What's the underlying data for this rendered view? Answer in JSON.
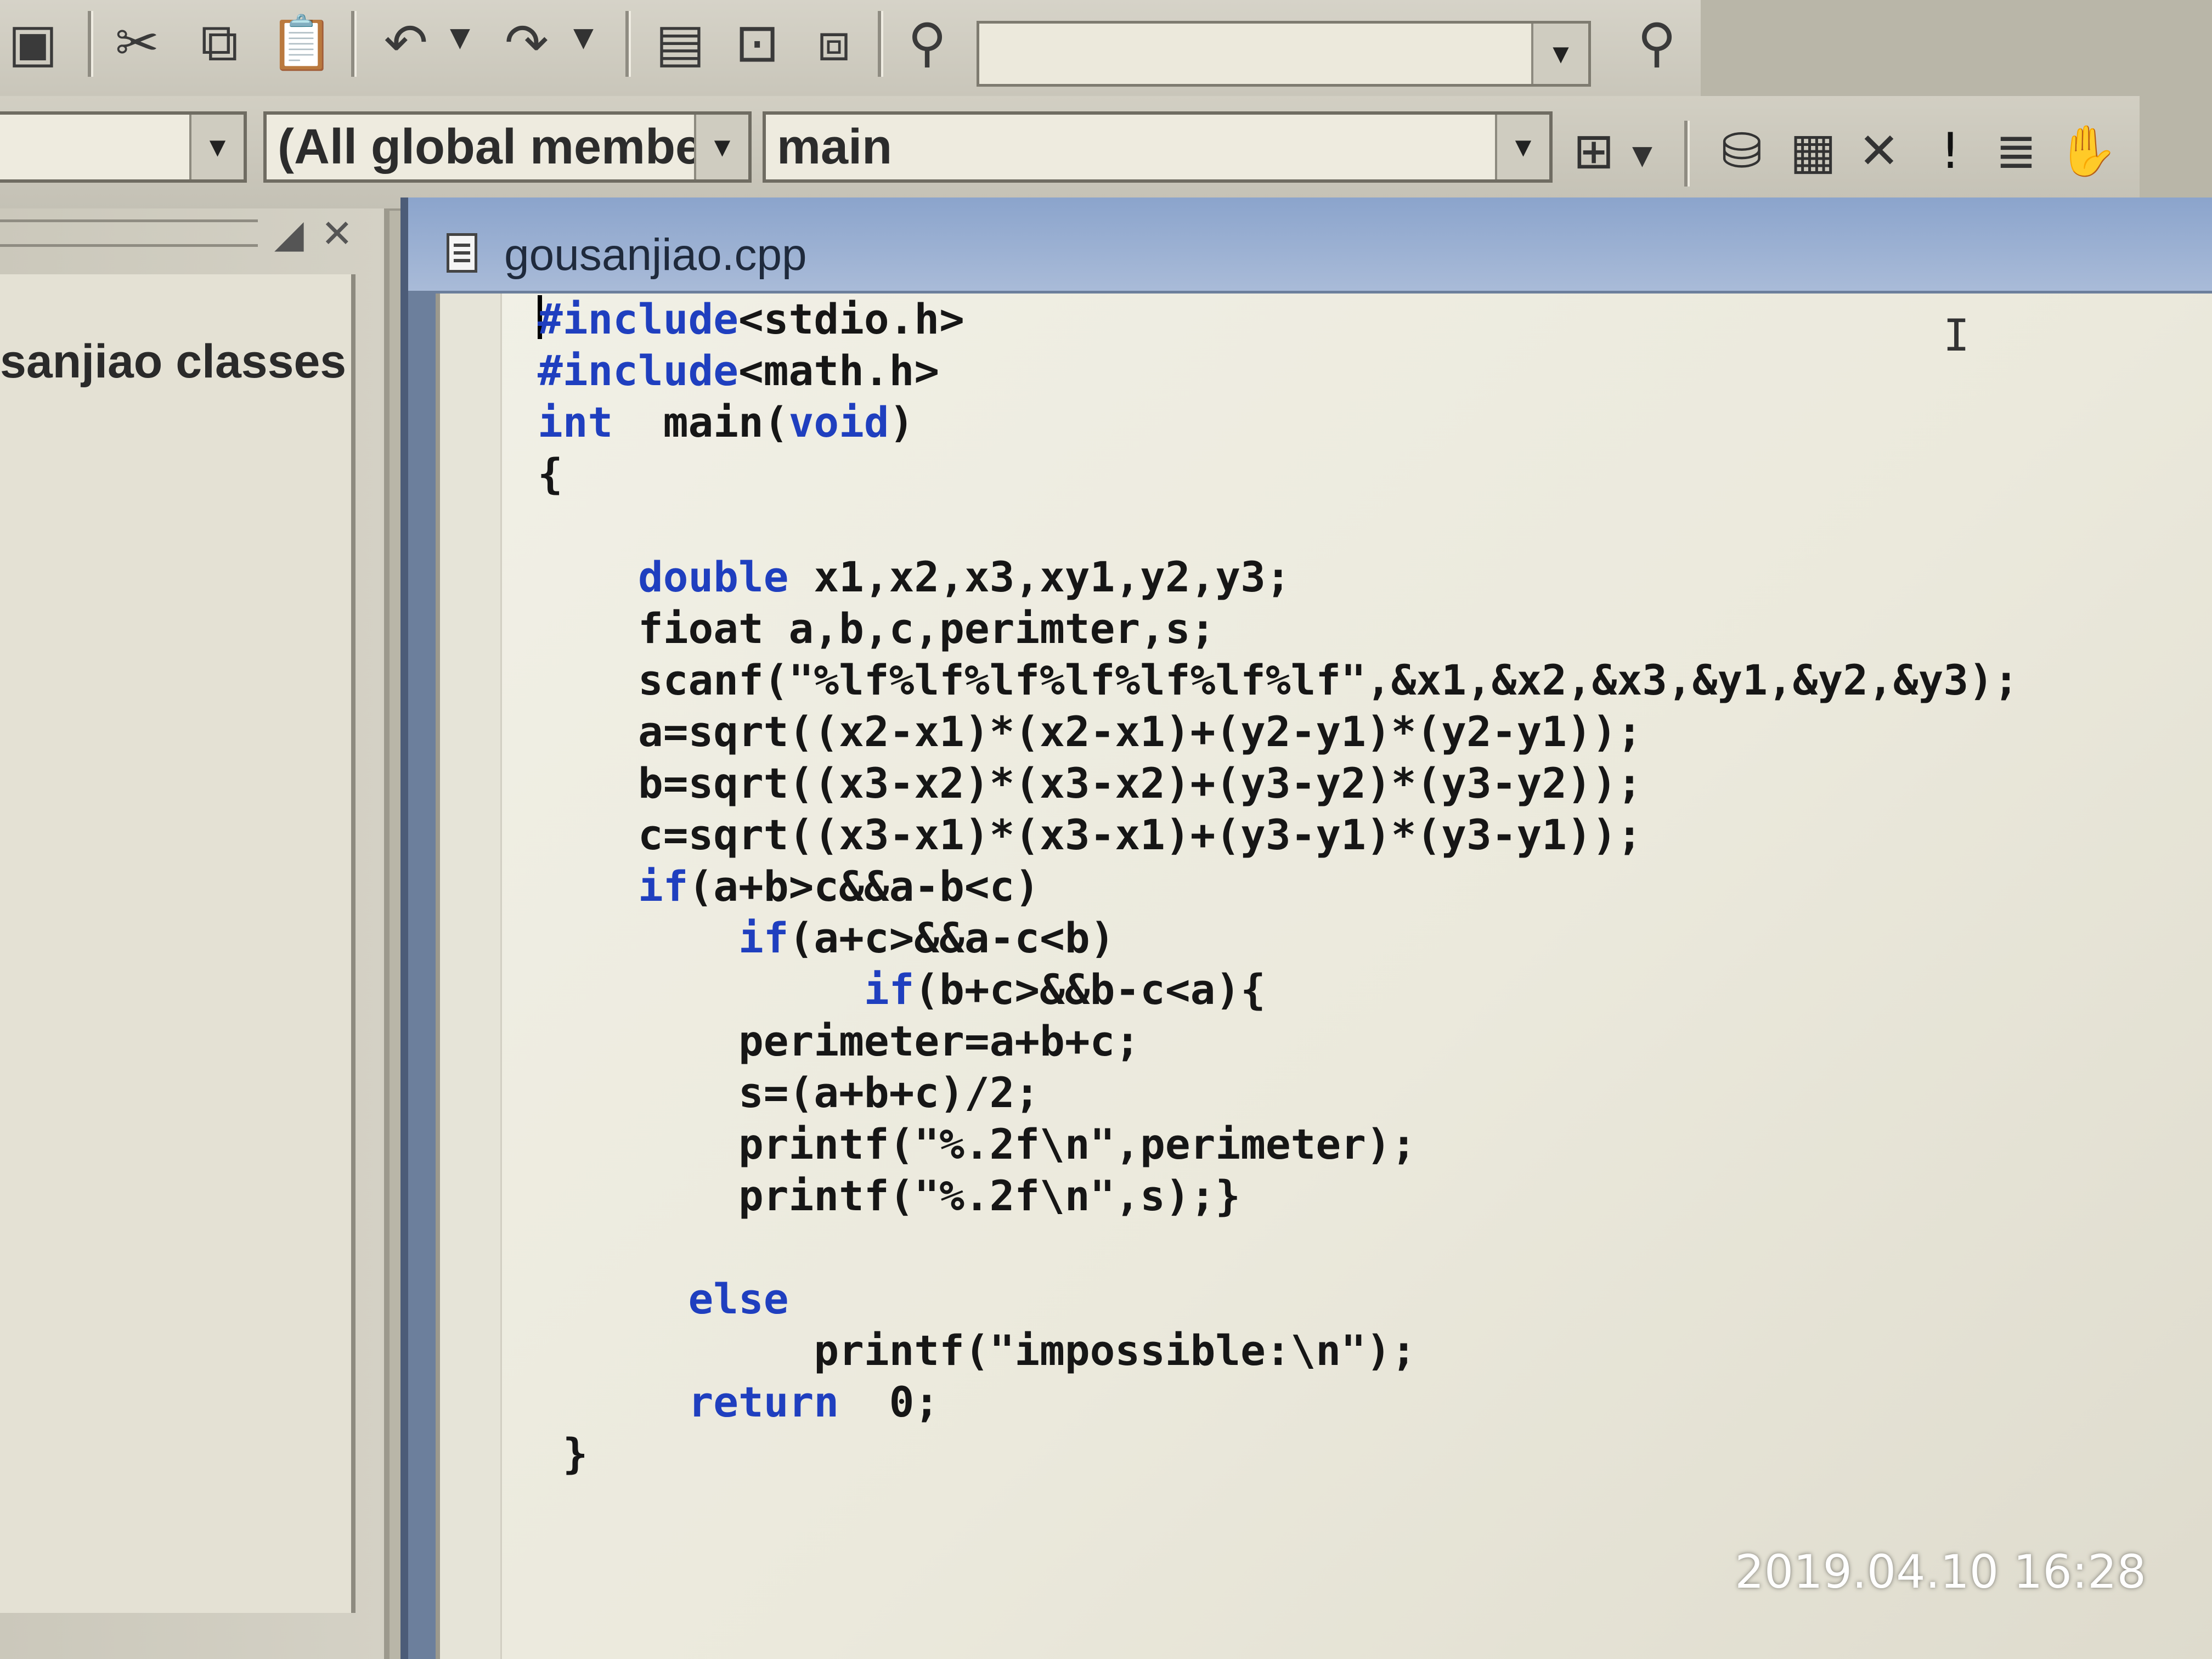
{
  "toolbar": {
    "find_value": "",
    "dropdown_glyph": "▼"
  },
  "wizard_bar": {
    "scope_value": "",
    "members_value": "(All global members",
    "function_value": "main"
  },
  "class_view": {
    "label": "sanjiao classes"
  },
  "editor": {
    "title": "gousanjiao.cpp",
    "lines": [
      [
        {
          "t": "#include",
          "k": true
        },
        {
          "t": "<stdio.h>"
        }
      ],
      [
        {
          "t": "#include",
          "k": true
        },
        {
          "t": "<math.h>"
        }
      ],
      [
        {
          "t": "int",
          "k": true
        },
        {
          "t": "  main("
        },
        {
          "t": "void",
          "k": true
        },
        {
          "t": ")"
        }
      ],
      [
        {
          "t": "{"
        }
      ],
      [
        {
          "t": ""
        }
      ],
      [
        {
          "t": "    "
        },
        {
          "t": "double",
          "k": true
        },
        {
          "t": " x1,x2,x3,xy1,y2,y3;"
        }
      ],
      [
        {
          "t": "    fioat a,b,c,perimter,s;"
        }
      ],
      [
        {
          "t": "    scanf(\"%lf%lf%lf%lf%lf%lf%lf\",&x1,&x2,&x3,&y1,&y2,&y3);"
        }
      ],
      [
        {
          "t": "    a=sqrt((x2-x1)*(x2-x1)+(y2-y1)*(y2-y1));"
        }
      ],
      [
        {
          "t": "    b=sqrt((x3-x2)*(x3-x2)+(y3-y2)*(y3-y2));"
        }
      ],
      [
        {
          "t": "    c=sqrt((x3-x1)*(x3-x1)+(y3-y1)*(y3-y1));"
        }
      ],
      [
        {
          "t": "    "
        },
        {
          "t": "if",
          "k": true
        },
        {
          "t": "(a+b>c&&a-b<c)"
        }
      ],
      [
        {
          "t": "        "
        },
        {
          "t": "if",
          "k": true
        },
        {
          "t": "(a+c>&&a-c<b)"
        }
      ],
      [
        {
          "t": "             "
        },
        {
          "t": "if",
          "k": true
        },
        {
          "t": "(b+c>&&b-c<a){"
        }
      ],
      [
        {
          "t": "        perimeter=a+b+c;"
        }
      ],
      [
        {
          "t": "        s=(a+b+c)/2;"
        }
      ],
      [
        {
          "t": "        printf(\"%.2f\\n\",perimeter);"
        }
      ],
      [
        {
          "t": "        printf(\"%.2f\\n\",s);}"
        }
      ],
      [
        {
          "t": ""
        }
      ],
      [
        {
          "t": "      "
        },
        {
          "t": "else",
          "k": true
        }
      ],
      [
        {
          "t": "           printf(\"impossible:\\n\");"
        }
      ],
      [
        {
          "t": "      "
        },
        {
          "t": "return",
          "k": true
        },
        {
          "t": "  0;"
        }
      ],
      [
        {
          "t": " }"
        }
      ]
    ]
  },
  "photo_timestamp": "2019.04.10 16:28",
  "colors": {
    "keyword": "#1f3fbf",
    "code_text": "#161616",
    "editor_bg": "#efede2",
    "title_bar": "#9bb1d4"
  },
  "icons": [
    "workspace-icon",
    "cut-icon",
    "copy-icon",
    "paste-icon",
    "undo-icon",
    "redo-icon",
    "workspace-window-icon",
    "output-window-icon",
    "window-list-icon",
    "find-in-files-icon",
    "find-icon",
    "wizard-action-icon",
    "compile-icon",
    "build-icon",
    "stop-build-icon",
    "execute-icon",
    "step-icon",
    "breakpoint-hand-icon"
  ]
}
